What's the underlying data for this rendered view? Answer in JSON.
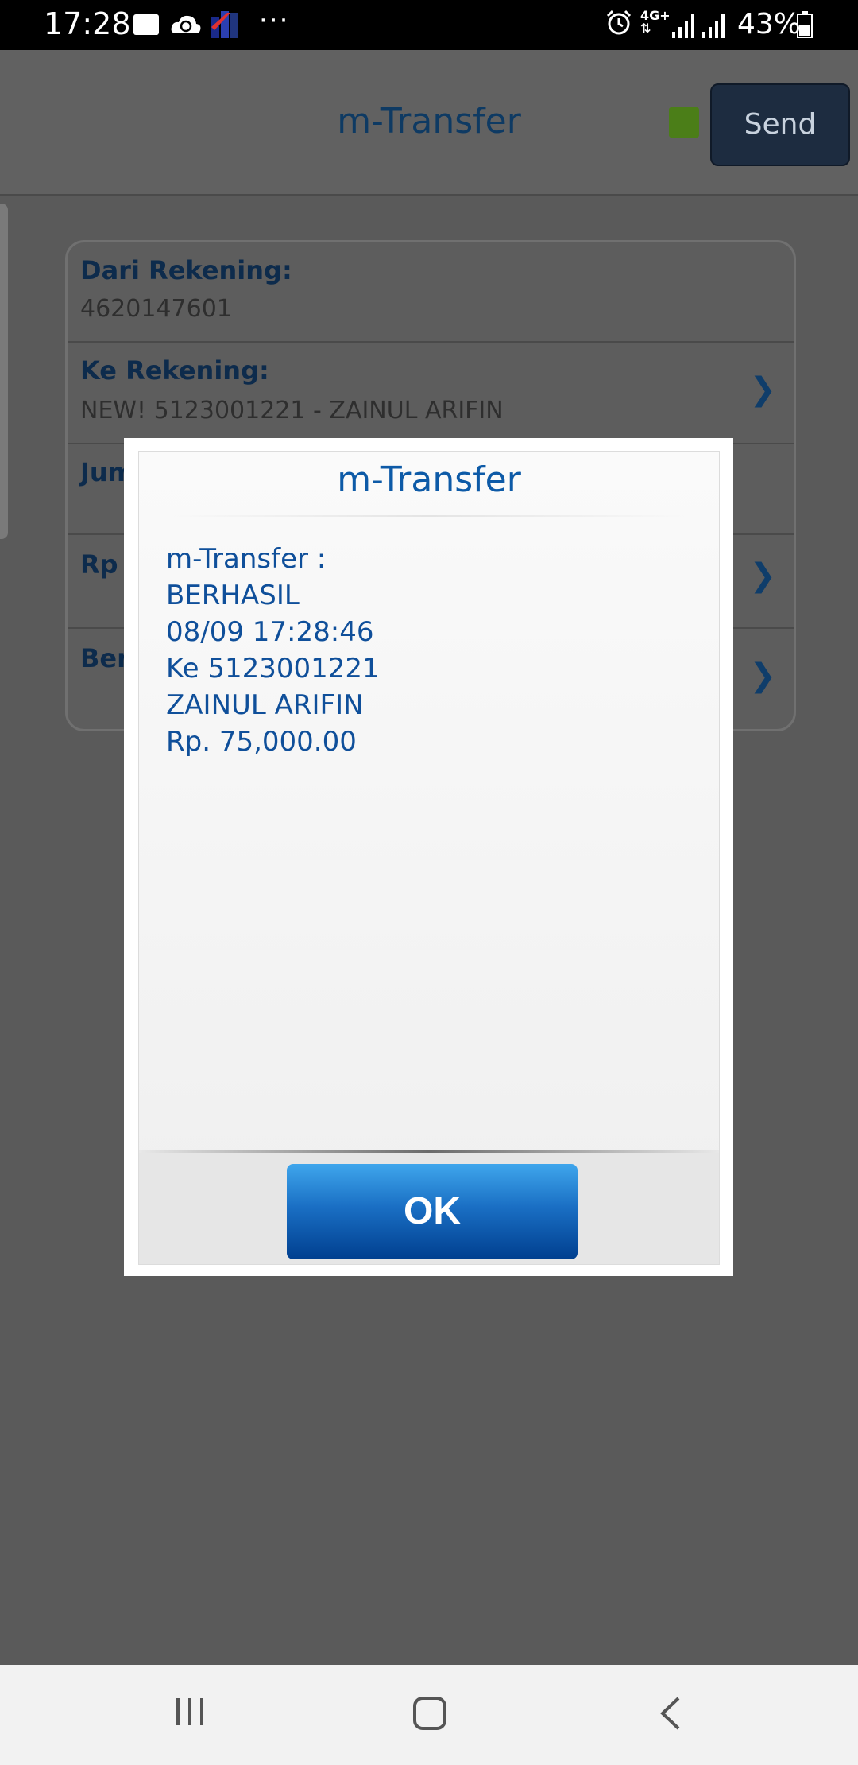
{
  "status_bar": {
    "time": "17:28",
    "dots": "···",
    "network_type": "4G+",
    "battery_percent": "43%",
    "icons": [
      "folder-icon",
      "cloud-sync-icon",
      "app-notification-icon",
      "alarm-icon",
      "network-arrows-icon",
      "signal-icon",
      "signal-icon",
      "battery-icon"
    ]
  },
  "header": {
    "title": "m-Transfer",
    "send_label": "Send",
    "status_indicator_color": "#4b7e18"
  },
  "form": {
    "rows": [
      {
        "label": "Dari Rekening:",
        "value": "4620147601"
      },
      {
        "label": "Ke Rekening:",
        "value": "NEW! 5123001221 - ZAINUL ARIFIN"
      },
      {
        "label": "Jum",
        "value": ""
      },
      {
        "label": "Rp",
        "value": ""
      },
      {
        "label": "Ber",
        "value": ""
      }
    ]
  },
  "dialog": {
    "title": "m-Transfer",
    "message_lines": [
      "m-Transfer :",
      "BERHASIL",
      "08/09 17:28:46",
      "Ke 5123001221",
      "ZAINUL ARIFIN",
      "Rp. 75,000.00"
    ],
    "ok_label": "OK"
  },
  "nav": {
    "icons": [
      "recent-apps-icon",
      "home-icon",
      "back-icon"
    ]
  }
}
